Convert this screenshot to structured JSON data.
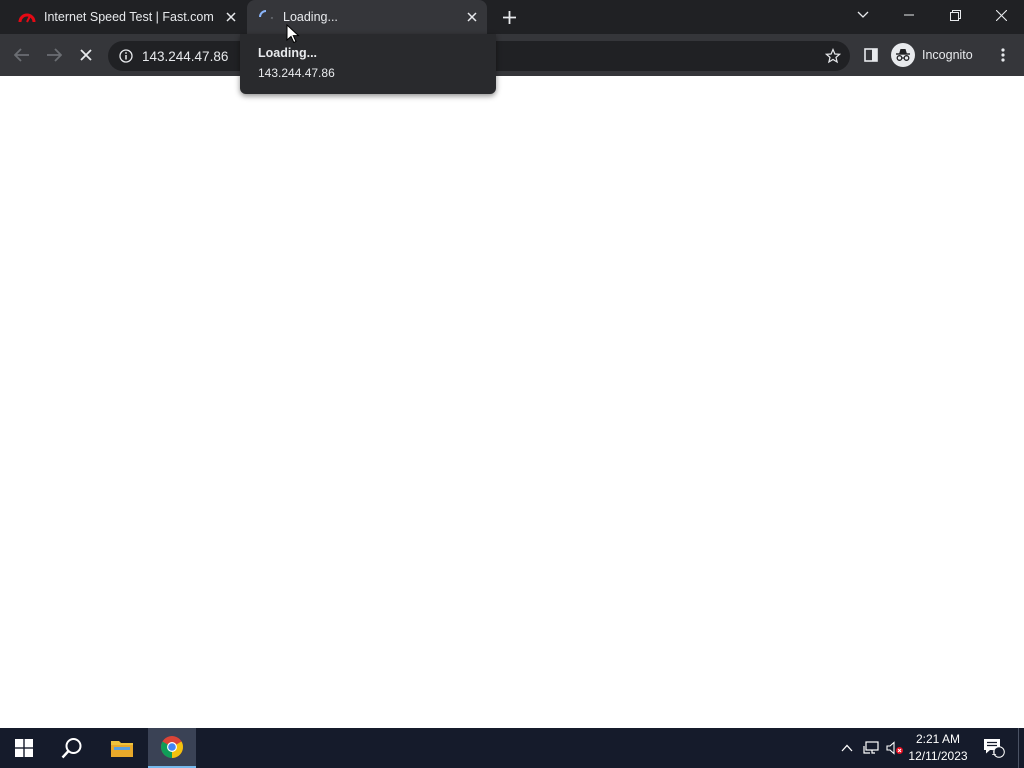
{
  "browser": {
    "tabs": [
      {
        "title": "Internet Speed Test | Fast.com",
        "favicon": "fast-com-speedometer-icon",
        "active": false
      },
      {
        "title": "Loading...",
        "favicon": "loading-spinner-icon",
        "active": true
      }
    ],
    "address_bar": {
      "url": "143.244.47.86"
    },
    "profile": {
      "label": "Incognito"
    },
    "hovercard": {
      "title": "Loading...",
      "url": "143.244.47.86"
    }
  },
  "taskbar": {
    "time": "2:21 AM",
    "date": "12/11/2023",
    "notification_count": "1"
  },
  "colors": {
    "tabstrip": "#202124",
    "toolbar": "#35363a",
    "omnibox": "#202124",
    "taskbar": "#151b2b",
    "fast_red": "#e50914"
  }
}
